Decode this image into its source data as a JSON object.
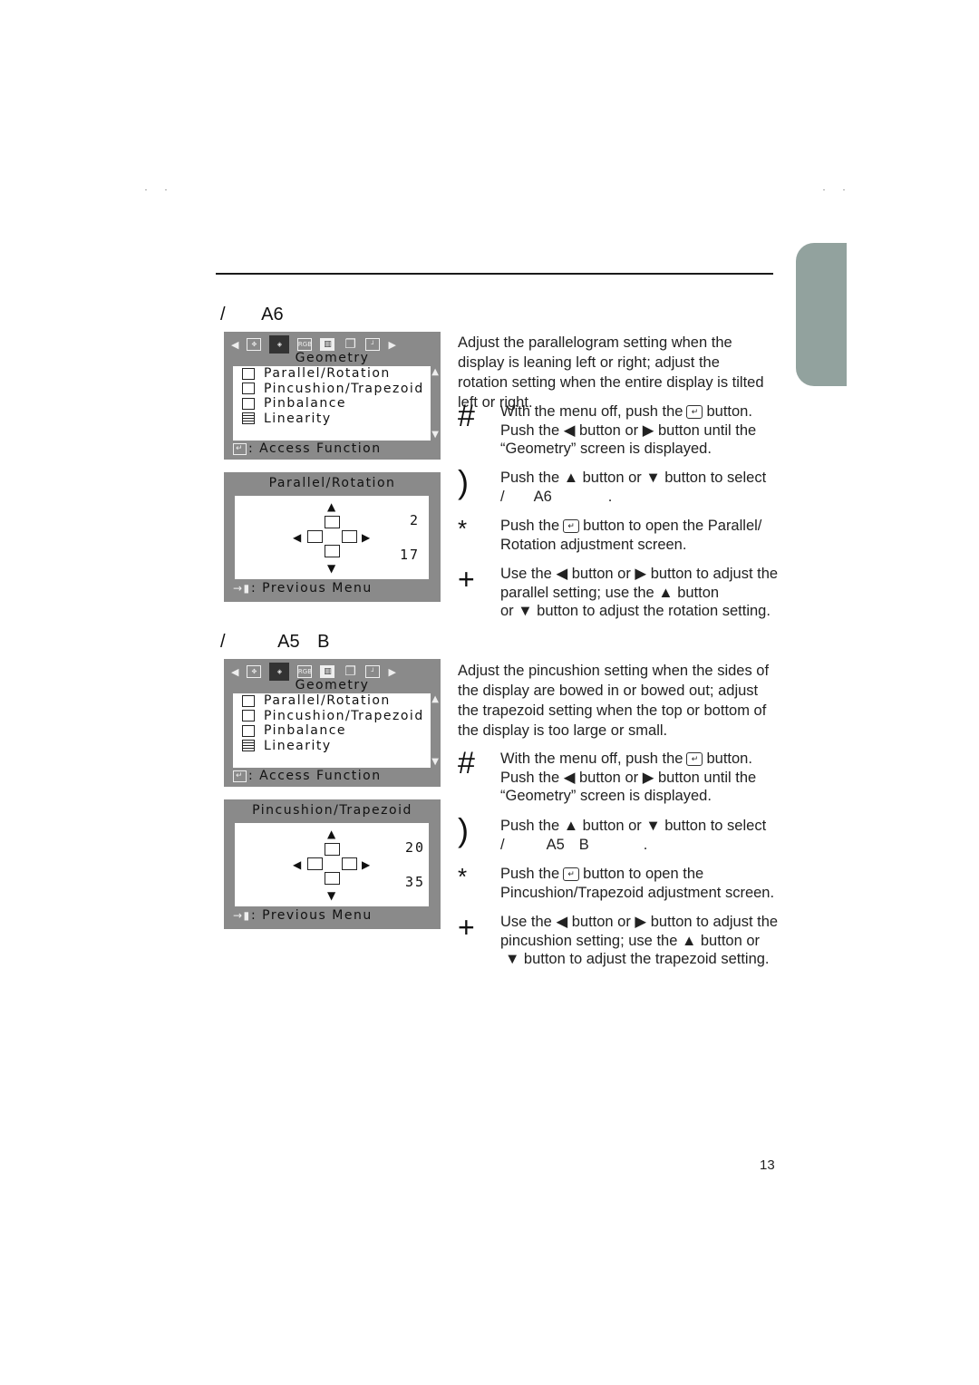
{
  "page": {
    "page_number": "13",
    "tab_color": "#92a29e",
    "rule_color": "#1a1a1a"
  },
  "section1": {
    "title_parts": [
      "/",
      "A6"
    ],
    "osd_menu": {
      "heading": "Geometry",
      "icons": [
        "left-arrow",
        "position-icon",
        "geometry-icon",
        "rgb-icon",
        "color-bars-icon",
        "pages-icon",
        "window-icon",
        "right-arrow"
      ],
      "rgb_label": "RGB",
      "items": [
        "Parallel/Rotation",
        "Pincushion/Trapezoid",
        "Pinbalance",
        "Linearity"
      ],
      "footer": ": Access Function"
    },
    "osd_adjust": {
      "heading": "Parallel/Rotation",
      "value_top": "2",
      "value_bottom": "17",
      "footer": ": Previous Menu"
    },
    "intro": "Adjust the parallelogram setting when the display is leaning left or right; adjust the rotation setting when the entire display is tilted left or right.",
    "steps": [
      {
        "bullet": "#",
        "lines": [
          "With the menu off, push the [enter] button.",
          "Push the ◀ button or ▶ button until the",
          "“Geometry” screen is displayed."
        ]
      },
      {
        "bullet": ")",
        "lines": [
          "Push the ▲ button or ▼ button to select",
          "/        A6              ."
        ]
      },
      {
        "bullet": "*",
        "lines": [
          "Push the [enter] button to open the Parallel/",
          "Rotation adjustment screen."
        ]
      },
      {
        "bullet": "+",
        "lines": [
          "Use the ◀ button or ▶ button to adjust the",
          "parallel setting; use the ▲ button",
          "or ▼ button to adjust the rotation setting."
        ]
      }
    ]
  },
  "section2": {
    "title_parts": [
      "/",
      "A5",
      "B"
    ],
    "osd_menu": {
      "heading": "Geometry",
      "rgb_label": "RGB",
      "items": [
        "Parallel/Rotation",
        "Pincushion/Trapezoid",
        "Pinbalance",
        "Linearity"
      ],
      "footer": ": Access Function"
    },
    "osd_adjust": {
      "heading": "Pincushion/Trapezoid",
      "value_top": "20",
      "value_bottom": "35",
      "footer": ": Previous Menu"
    },
    "intro": "Adjust the pincushion setting when the sides of the display are bowed in or bowed out; adjust the trapezoid setting when the top or bottom of the display is too large or small.",
    "steps": [
      {
        "bullet": "#",
        "lines": [
          "With the menu off, push the [enter] button.",
          "Push the ◀ button or ▶ button until the",
          "“Geometry” screen is displayed."
        ]
      },
      {
        "bullet": ")",
        "lines": [
          "Push the ▲ button or ▼ button to select",
          "/          A5    B             ."
        ]
      },
      {
        "bullet": "*",
        "lines": [
          "Push the [enter] button to open the",
          "Pincushion/Trapezoid adjustment screen."
        ]
      },
      {
        "bullet": "+",
        "lines": [
          "Use the ◀ button or ▶ button to adjust the",
          "pincushion setting; use the ▲ button or",
          " ▼ button to adjust the trapezoid setting."
        ]
      }
    ]
  },
  "text": {
    "with_menu_off": "With the menu off, push the",
    "button_dot": "button.",
    "push_lr": "Push the ◀ button or ▶ button until the",
    "geometry_displayed": "“Geometry” screen is displayed.",
    "push_ud": "Push the ▲ button or ▼ button to select",
    "push_the": "Push the",
    "s1_open": "button to open the Parallel/",
    "s1_open2": "Rotation adjustment screen.",
    "s2_open": "button to open the",
    "s2_open2": "Pincushion/Trapezoid adjustment screen.",
    "s1_use1": "Use the ◀ button or ▶ button to adjust the",
    "s1_use2": "parallel setting; use the ▲ button",
    "s1_use3": "or ▼ button to adjust the rotation setting.",
    "s2_use1": "Use the ◀ button or ▶ button to adjust the",
    "s2_use2": "pincushion setting; use the ▲ button or",
    "s2_use3": "▼ button to adjust the trapezoid setting.",
    "slash": "/",
    "a6": "A6",
    "a5": "A5",
    "b": "B",
    "dot": ".",
    "enter_glyph": "↵"
  }
}
